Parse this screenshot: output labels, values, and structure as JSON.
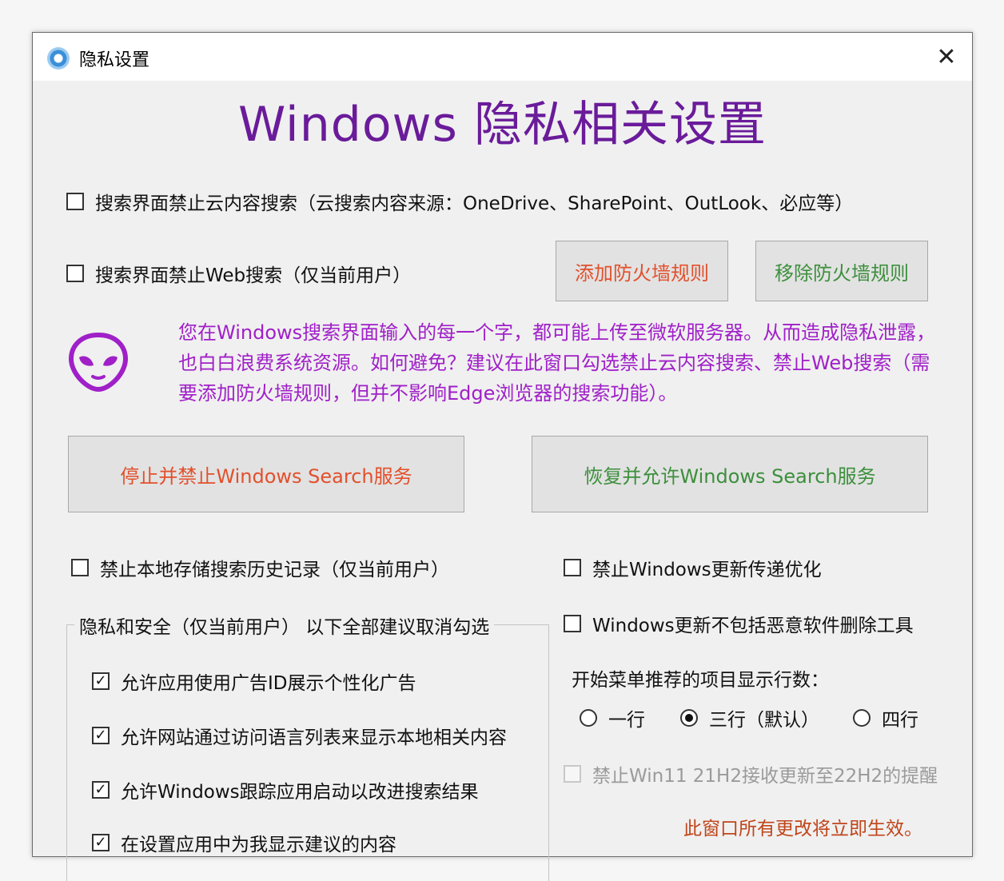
{
  "window": {
    "title": "隐私设置",
    "close_glyph": "✕",
    "heading": "Windows 隐私相关设置"
  },
  "search": {
    "disable_cloud_search": {
      "label": "搜索界面禁止云内容搜索（云搜索内容来源：OneDrive、SharePoint、OutLook、必应等）",
      "checked": false
    },
    "disable_web_search": {
      "label": "搜索界面禁止Web搜索（仅当前用户）",
      "checked": false
    },
    "add_firewall_rule": "添加防火墙规则",
    "remove_firewall_rule": "移除防火墙规则"
  },
  "info": {
    "icon": "alien-icon",
    "text": "您在Windows搜索界面输入的每一个字，都可能上传至微软服务器。从而造成隐私泄露，也白白浪费系统资源。如何避免？建议在此窗口勾选禁止云内容搜索、禁止Web搜索（需要添加防火墙规则，但并不影响Edge浏览器的搜索功能）。"
  },
  "service": {
    "stop_label": "停止并禁止Windows Search服务",
    "restore_label": "恢复并允许Windows Search服务"
  },
  "local_history": {
    "label": "禁止本地存储搜索历史记录（仅当前用户）",
    "checked": false
  },
  "privacy_group": {
    "title": "隐私和安全（仅当前用户） 以下全部建议取消勾选",
    "items": [
      {
        "label": "允许应用使用广告ID展示个性化广告",
        "checked": true
      },
      {
        "label": "允许网站通过访问语言列表来显示本地相关内容",
        "checked": true
      },
      {
        "label": "允许Windows跟踪应用启动以改进搜索结果",
        "checked": true
      },
      {
        "label": "在设置应用中为我显示建议的内容",
        "checked": true
      }
    ]
  },
  "update": {
    "delivery_opt": {
      "label": "禁止Windows更新传递优化",
      "checked": false
    },
    "exclude_mrt": {
      "label": "Windows更新不包括恶意软件删除工具",
      "checked": false
    }
  },
  "start_menu": {
    "label": "开始菜单推荐的项目显示行数：",
    "options": [
      {
        "label": "一行",
        "checked": false
      },
      {
        "label": "三行（默认）",
        "checked": true
      },
      {
        "label": "四行",
        "checked": false
      }
    ]
  },
  "win11": {
    "label": "禁止Win11 21H2接收更新至22H2的提醒",
    "checked": false,
    "disabled": true
  },
  "footer_note": "此窗口所有更改将立即生效。",
  "colors": {
    "heading": "#6a1b9a",
    "info_text": "#a020c8",
    "stop_text": "#e2502c",
    "restore_text": "#3c8f3c",
    "note_text": "#c0451a"
  }
}
